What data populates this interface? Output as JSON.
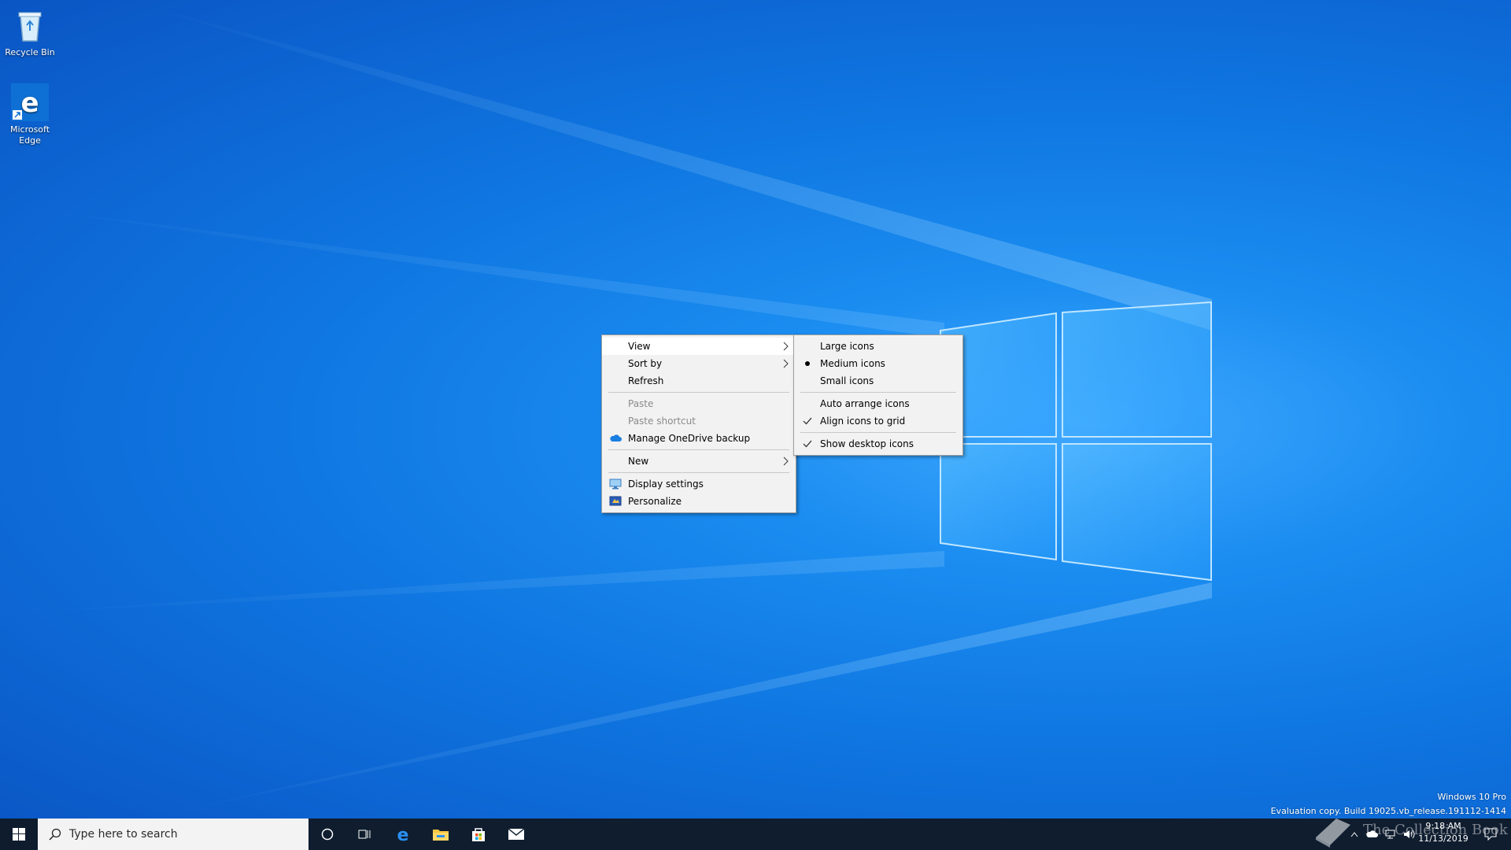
{
  "desktop": {
    "icons": [
      {
        "label": "Recycle Bin",
        "icon": "recycle-bin-icon"
      },
      {
        "label": "Microsoft Edge",
        "icon": "edge-icon"
      }
    ]
  },
  "context_menu": {
    "items": [
      {
        "label": "View",
        "submenu": true,
        "highlighted": true
      },
      {
        "label": "Sort by",
        "submenu": true
      },
      {
        "label": "Refresh"
      },
      {
        "label": "Paste",
        "disabled": true
      },
      {
        "label": "Paste shortcut",
        "disabled": true
      },
      {
        "label": "Manage OneDrive backup",
        "icon": "onedrive-icon"
      },
      {
        "label": "New",
        "submenu": true
      },
      {
        "label": "Display settings",
        "icon": "display-icon"
      },
      {
        "label": "Personalize",
        "icon": "personalize-icon"
      }
    ]
  },
  "view_submenu": {
    "items": [
      {
        "label": "Large icons"
      },
      {
        "label": "Medium icons",
        "marker": "bullet"
      },
      {
        "label": "Small icons"
      },
      {
        "label": "Auto arrange icons"
      },
      {
        "label": "Align icons to grid",
        "marker": "check"
      },
      {
        "label": "Show desktop icons",
        "marker": "check"
      }
    ]
  },
  "taskbar": {
    "search_placeholder": "Type here to search",
    "apps": [
      "cortana-icon",
      "task-view-icon",
      "edge-icon",
      "file-explorer-icon",
      "store-icon",
      "mail-icon"
    ],
    "clock": {
      "time": "9:18 AM",
      "date": "11/13/2019"
    }
  },
  "watermark": {
    "edition": "Windows 10 Pro",
    "build": "Evaluation copy. Build 19025.vb_release.191112-1414",
    "overlay": "The Collection Book"
  },
  "colors": {
    "desktop_blue": "#1a8cf0",
    "menu_bg": "#f2f2f2",
    "taskbar_bg": "#101a28"
  }
}
